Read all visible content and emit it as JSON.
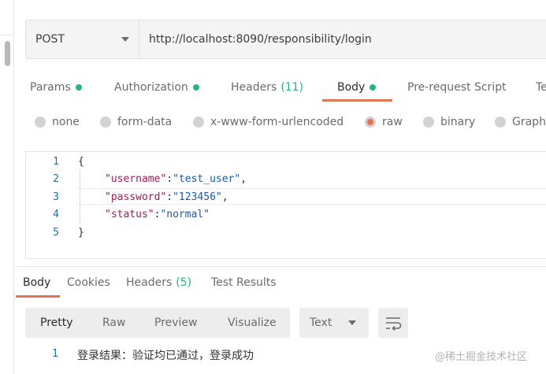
{
  "request": {
    "method": "POST",
    "url": "http://localhost:8090/responsibility/login"
  },
  "request_tabs": [
    {
      "label": "Params",
      "dot": true
    },
    {
      "label": "Authorization",
      "dot": true
    },
    {
      "label": "Headers",
      "count": "(11)"
    },
    {
      "label": "Body",
      "dot": true,
      "active": true
    },
    {
      "label": "Pre-request Script"
    },
    {
      "label": "Te"
    }
  ],
  "body_modes": [
    {
      "label": "none",
      "selected": false
    },
    {
      "label": "form-data",
      "selected": false
    },
    {
      "label": "x-www-form-urlencoded",
      "selected": false
    },
    {
      "label": "raw",
      "selected": true
    },
    {
      "label": "binary",
      "selected": false
    },
    {
      "label": "Graph",
      "selected": false
    }
  ],
  "editor": {
    "line_numbers": [
      "1",
      "2",
      "3",
      "4",
      "5"
    ],
    "open_brace": "{",
    "close_brace": "}",
    "fields": [
      {
        "key": "\"username\"",
        "sep": ":",
        "value": "\"test_user\"",
        "trail": ","
      },
      {
        "key": "\"password\"",
        "sep": ":",
        "value": "\"123456\"",
        "trail": ","
      },
      {
        "key": "\"status\"",
        "sep": ":",
        "value": "\"normal\"",
        "trail": ""
      }
    ]
  },
  "response_tabs": [
    {
      "label": "Body",
      "active": true
    },
    {
      "label": "Cookies"
    },
    {
      "label": "Headers",
      "count": "(5)"
    },
    {
      "label": "Test Results"
    }
  ],
  "view_modes": [
    "Pretty",
    "Raw",
    "Preview",
    "Visualize"
  ],
  "format": "Text",
  "response": {
    "line_number": "1",
    "text": "登录结果：验证均已通过，登录成功"
  },
  "watermark": "@稀土掘金技术社区",
  "colors": {
    "accent": "#e2754f",
    "green_dot": "#26b47f",
    "json_key": "#9b1d5c",
    "json_string": "#1a5aa6",
    "line_number": "#1f6e9e"
  }
}
